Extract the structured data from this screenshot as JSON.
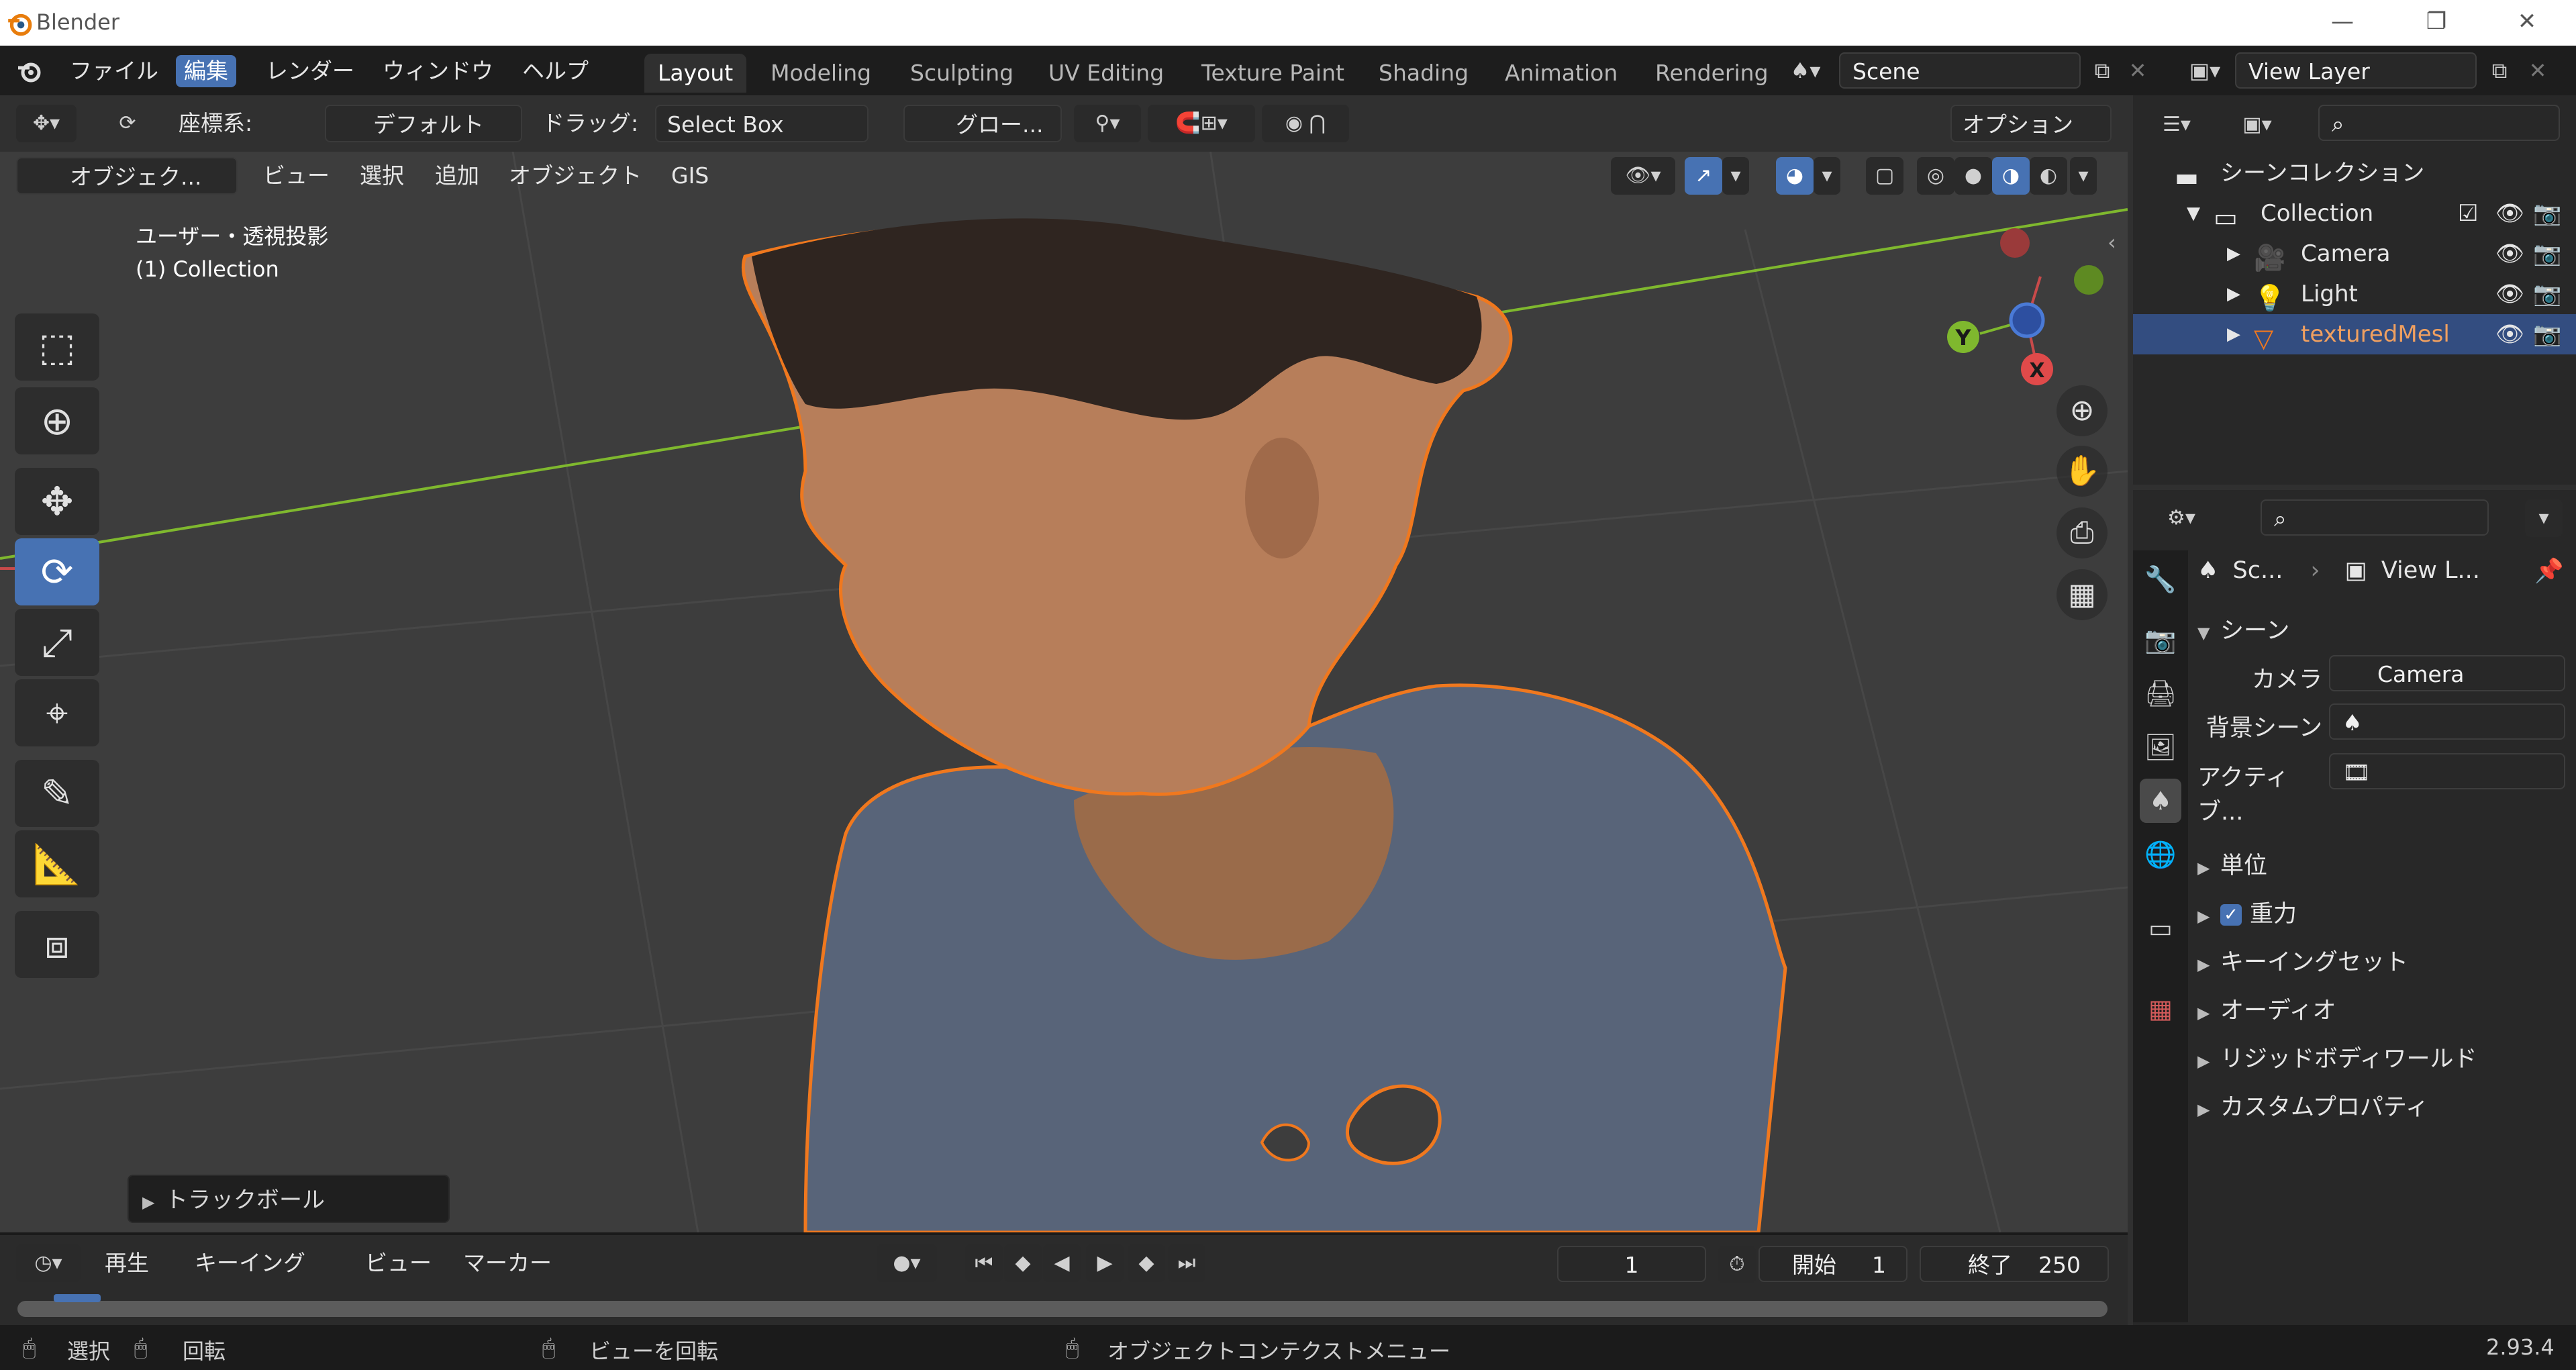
{
  "window": {
    "title": "Blender",
    "minimize": "—",
    "restore": "❐",
    "close": "✕"
  },
  "menus": [
    "ファイル",
    "編集",
    "レンダー",
    "ウィンドウ",
    "ヘルプ"
  ],
  "workspaces": [
    "Layout",
    "Modeling",
    "Sculpting",
    "UV Editing",
    "Texture Paint",
    "Shading",
    "Animation",
    "Rendering"
  ],
  "scene_field": "Scene",
  "viewlayer_field": "View Layer",
  "toolheader": {
    "coord_label": "座標系:",
    "orientation": "デフォルト",
    "drag_label": "ドラッグ:",
    "drag_value": "Select Box",
    "pivot": "グロー...",
    "options": "オプション"
  },
  "viewheader": {
    "mode": "オブジェク...",
    "view": "ビュー",
    "select": "選択",
    "add": "追加",
    "object": "オブジェクト",
    "gis": "GIS"
  },
  "viewport": {
    "projection": "ユーザー・透視投影",
    "collection": "(1) Collection",
    "last_op": "トラックボール",
    "gizmo": {
      "y": "Y",
      "x": "X"
    }
  },
  "timeline": {
    "playback": "再生",
    "keying": "キーイング",
    "view": "ビュー",
    "marker": "マーカー",
    "current_frame": "1",
    "start_label": "開始",
    "start_value": "1",
    "end_label": "終了",
    "end_value": "250"
  },
  "status": {
    "select": "選択",
    "rotate": "回転",
    "rotate_view": "ビューを回転",
    "context_menu": "オブジェクトコンテクストメニュー",
    "version": "2.93.4"
  },
  "outliner": {
    "scene_collection": "シーンコレクション",
    "items": [
      {
        "name": "Collection"
      },
      {
        "name": "Camera"
      },
      {
        "name": "Light"
      },
      {
        "name": "texturedMesl"
      }
    ]
  },
  "properties": {
    "breadcrumb_scene": "Sc...",
    "breadcrumb_layer": "View L...",
    "scene_panel": "シーン",
    "camera_label": "カメラ",
    "camera_value": "Camera",
    "bg_scene_label": "背景シーン",
    "active_label": "アクティブ...",
    "panels": [
      "単位",
      "重力",
      "キーイングセット",
      "オーディオ",
      "リジッドボディワールド",
      "カスタムプロパティ"
    ]
  },
  "colors": {
    "accent": "#4772b3",
    "selection_outline": "#f0781e",
    "x_axis": "#e04a4a",
    "y_axis": "#7fb82e",
    "z_axis": "#4a7ad6"
  }
}
